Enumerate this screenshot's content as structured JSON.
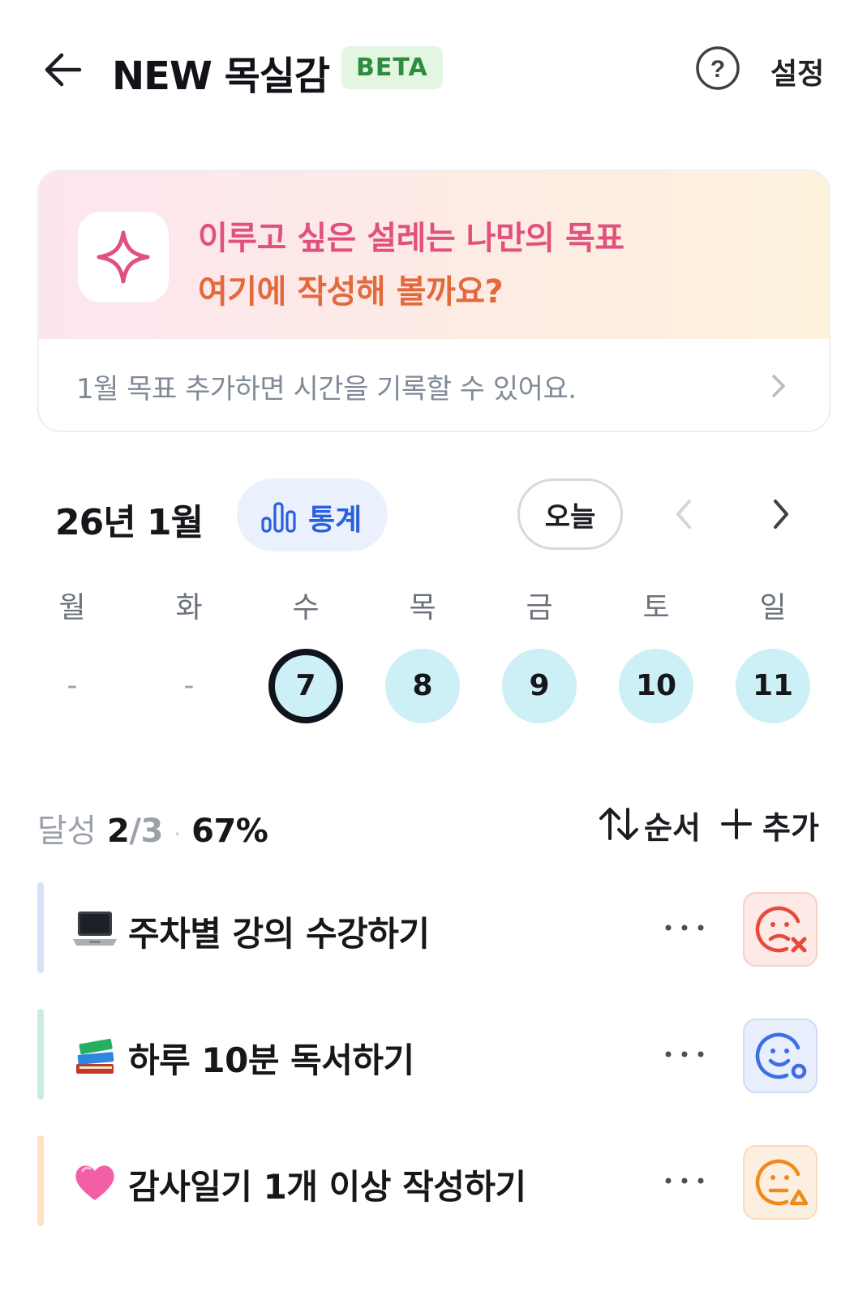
{
  "header": {
    "title": "NEW 목실감",
    "badge": "BETA",
    "settings_label": "설정"
  },
  "goal_card": {
    "line1": "이루고 싶은 설레는 나만의 목표",
    "line2": "여기에 작성해 볼까요?",
    "footer_text": "1월 목표  추가하면 시간을 기록할 수 있어요."
  },
  "calendar": {
    "month_label": "26년 1월",
    "stats_label": "통계",
    "today_label": "오늘",
    "weekdays": [
      "월",
      "화",
      "수",
      "목",
      "금",
      "토",
      "일"
    ],
    "days": [
      "-",
      "-",
      "7",
      "8",
      "9",
      "10",
      "11"
    ],
    "selected_day": "7"
  },
  "summary": {
    "label": "달성",
    "done": "2",
    "slash": "/",
    "total": "3",
    "separator": "·",
    "percent": "67%",
    "order_label": "순서",
    "add_label": "추가"
  },
  "goals": [
    {
      "text": "주차별 강의 수강하기",
      "emoji_icon": "laptop-icon",
      "bar_color": "#d6e2f8",
      "status_icon": "sad-face-x-icon",
      "status": "failed"
    },
    {
      "text": "하루 10분 독서하기",
      "emoji_icon": "books-icon",
      "bar_color": "#c9eedd",
      "status_icon": "happy-face-o-icon",
      "status": "done"
    },
    {
      "text": "감사일기 1개 이상 작성하기",
      "emoji_icon": "pink-heart-icon",
      "bar_color": "#fde2c4",
      "status_icon": "neutral-face-triangle-icon",
      "status": "partial"
    }
  ],
  "colors": {
    "accent_blue": "#2a5fdd",
    "day_circle": "#cdeff6",
    "status_fail": "#e8493b",
    "status_done": "#3c6ee4",
    "status_partial": "#f08a1c"
  }
}
